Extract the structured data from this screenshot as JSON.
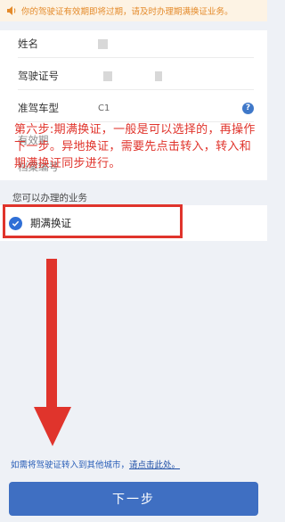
{
  "notice": {
    "text": "你的驾驶证有效期即将过期，请及时办理期满换证业务。"
  },
  "form": {
    "name_label": "姓名",
    "license_no_label": "驾驶证号",
    "vehicle_type_label": "准驾车型",
    "vehicle_type_value": "C1",
    "row4_label": "有效期",
    "row5_label": "档案编号"
  },
  "annotation": {
    "text": "第六步:期满换证，一般是可以选择的，再操作下一步。异地换证，需要先点击转入，转入和期满换证同步进行。"
  },
  "services": {
    "section_title": "您可以办理的业务",
    "item_label": "期满换证"
  },
  "footer": {
    "city_text": "如需将驾驶证转入到其他城市，",
    "city_link": "请点击此处。",
    "next_label": "下一步"
  },
  "colors": {
    "primary": "#3f6fc2",
    "annotation_red": "#e0342c",
    "notice_orange": "#e48a2a"
  }
}
